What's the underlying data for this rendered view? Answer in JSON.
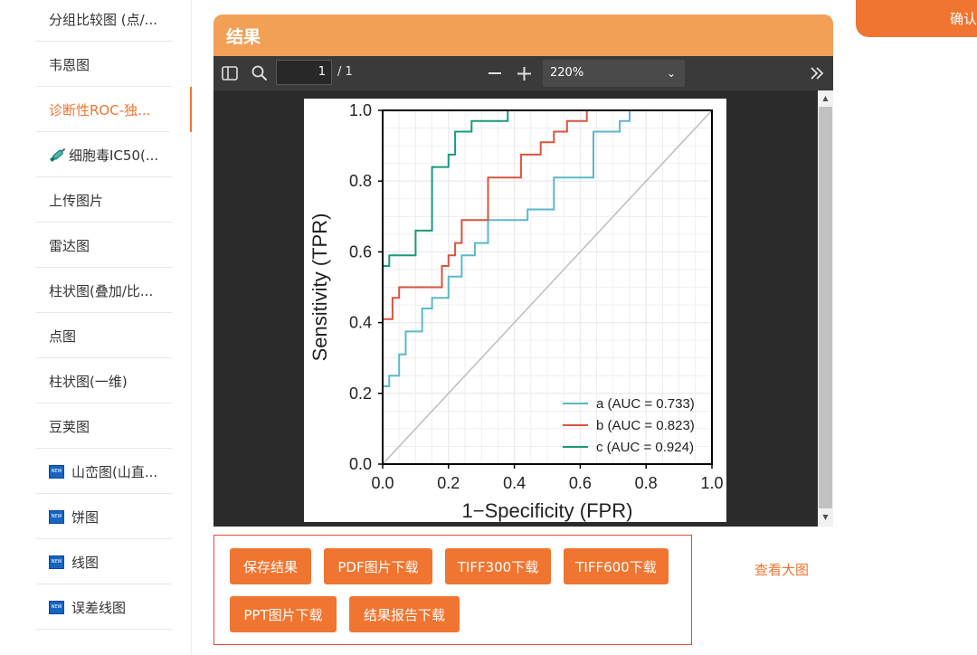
{
  "sidebar": {
    "items": [
      {
        "label": "分组比较图 (点/...",
        "icon": "",
        "active": false
      },
      {
        "label": "韦恩图",
        "icon": "",
        "active": false
      },
      {
        "label": "诊断性ROC-独...",
        "icon": "",
        "active": true
      },
      {
        "label": "细胞毒IC50(...",
        "icon": "syringe-icon",
        "active": false
      },
      {
        "label": "上传图片",
        "icon": "",
        "active": false
      },
      {
        "label": "雷达图",
        "icon": "",
        "active": false
      },
      {
        "label": "柱状图(叠加/比...",
        "icon": "",
        "active": false
      },
      {
        "label": "点图",
        "icon": "",
        "active": false
      },
      {
        "label": "柱状图(一维)",
        "icon": "",
        "active": false
      },
      {
        "label": "豆荚图",
        "icon": "",
        "active": false
      },
      {
        "label": "山峦图(山直...",
        "icon": "new-icon",
        "active": false
      },
      {
        "label": "饼图",
        "icon": "new-icon",
        "active": false
      },
      {
        "label": "线图",
        "icon": "new-icon",
        "active": false
      },
      {
        "label": "误差线图",
        "icon": "new-icon",
        "active": false
      }
    ],
    "new_badge_text": "NEW"
  },
  "header": {
    "confirm_label": "确认"
  },
  "result": {
    "title": "结果"
  },
  "viewer": {
    "page_value": "1",
    "page_total": "/ 1",
    "zoom": "220%"
  },
  "actions": {
    "save": "保存结果",
    "pdf": "PDF图片下载",
    "tiff300": "TIFF300下载",
    "tiff600": "TIFF600下载",
    "ppt": "PPT图片下载",
    "report": "结果报告下载",
    "view_large": "查看大图"
  },
  "colors": {
    "accent": "#f07530",
    "header": "#f2a056",
    "series_a": "#5bb8c9",
    "series_b": "#d9553f",
    "series_c": "#1a9a7e"
  },
  "chart_data": {
    "type": "line",
    "title": "",
    "xlabel": "1−Specificity (FPR)",
    "ylabel": "Sensitivity (TPR)",
    "xlim": [
      0,
      1
    ],
    "ylim": [
      0,
      1
    ],
    "x_ticks": [
      "0.0",
      "0.2",
      "0.4",
      "0.6",
      "0.8",
      "1.0"
    ],
    "y_ticks": [
      "0.0",
      "0.2",
      "0.4",
      "0.6",
      "0.8",
      "1.0"
    ],
    "grid": true,
    "legend_position": "bottom-right",
    "diagonal": true,
    "series": [
      {
        "name": "a (AUC = 0.733)",
        "color": "#5bb8c9",
        "points": [
          [
            0,
            0
          ],
          [
            0,
            0.22
          ],
          [
            0.02,
            0.22
          ],
          [
            0.02,
            0.25
          ],
          [
            0.05,
            0.25
          ],
          [
            0.05,
            0.31
          ],
          [
            0.07,
            0.31
          ],
          [
            0.07,
            0.375
          ],
          [
            0.12,
            0.375
          ],
          [
            0.12,
            0.44
          ],
          [
            0.15,
            0.44
          ],
          [
            0.15,
            0.47
          ],
          [
            0.2,
            0.47
          ],
          [
            0.2,
            0.53
          ],
          [
            0.24,
            0.53
          ],
          [
            0.24,
            0.59
          ],
          [
            0.28,
            0.59
          ],
          [
            0.28,
            0.625
          ],
          [
            0.32,
            0.625
          ],
          [
            0.32,
            0.69
          ],
          [
            0.44,
            0.69
          ],
          [
            0.44,
            0.72
          ],
          [
            0.52,
            0.72
          ],
          [
            0.52,
            0.81
          ],
          [
            0.64,
            0.81
          ],
          [
            0.64,
            0.94
          ],
          [
            0.72,
            0.94
          ],
          [
            0.72,
            0.97
          ],
          [
            0.75,
            0.97
          ],
          [
            0.75,
            1
          ],
          [
            1,
            1
          ]
        ]
      },
      {
        "name": "b (AUC = 0.823)",
        "color": "#d9553f",
        "points": [
          [
            0,
            0
          ],
          [
            0,
            0.41
          ],
          [
            0.03,
            0.41
          ],
          [
            0.03,
            0.47
          ],
          [
            0.05,
            0.47
          ],
          [
            0.05,
            0.5
          ],
          [
            0.18,
            0.5
          ],
          [
            0.18,
            0.56
          ],
          [
            0.2,
            0.56
          ],
          [
            0.2,
            0.59
          ],
          [
            0.22,
            0.59
          ],
          [
            0.22,
            0.625
          ],
          [
            0.24,
            0.625
          ],
          [
            0.24,
            0.69
          ],
          [
            0.32,
            0.69
          ],
          [
            0.32,
            0.81
          ],
          [
            0.42,
            0.81
          ],
          [
            0.42,
            0.875
          ],
          [
            0.48,
            0.875
          ],
          [
            0.48,
            0.91
          ],
          [
            0.52,
            0.91
          ],
          [
            0.52,
            0.94
          ],
          [
            0.56,
            0.94
          ],
          [
            0.56,
            0.97
          ],
          [
            0.62,
            0.97
          ],
          [
            0.62,
            1
          ],
          [
            1,
            1
          ]
        ]
      },
      {
        "name": "c (AUC = 0.924)",
        "color": "#1a9a7e",
        "points": [
          [
            0,
            0
          ],
          [
            0,
            0.56
          ],
          [
            0.02,
            0.56
          ],
          [
            0.02,
            0.59
          ],
          [
            0.1,
            0.59
          ],
          [
            0.1,
            0.66
          ],
          [
            0.15,
            0.66
          ],
          [
            0.15,
            0.84
          ],
          [
            0.2,
            0.84
          ],
          [
            0.2,
            0.875
          ],
          [
            0.22,
            0.875
          ],
          [
            0.22,
            0.94
          ],
          [
            0.27,
            0.94
          ],
          [
            0.27,
            0.97
          ],
          [
            0.38,
            0.97
          ],
          [
            0.38,
            1
          ],
          [
            1,
            1
          ]
        ]
      }
    ]
  }
}
